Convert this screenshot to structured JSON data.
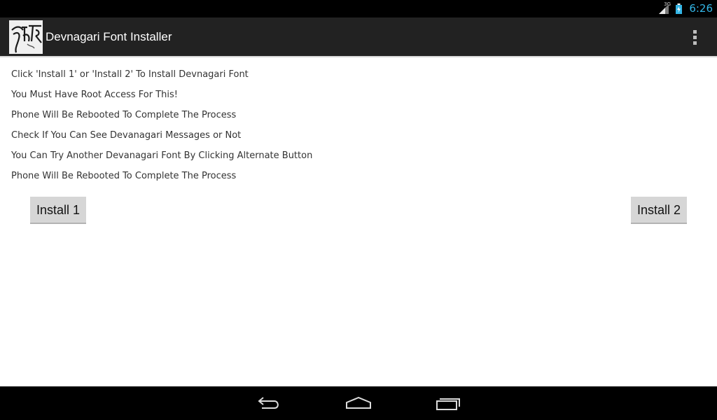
{
  "status_bar": {
    "network_type": "3G",
    "time": "6:26",
    "icons": [
      "signal-icon",
      "battery-charging-icon"
    ]
  },
  "action_bar": {
    "title": "Devnagari Font Installer",
    "logo_icon": "app-logo-icon",
    "menu_icon": "overflow-menu-icon"
  },
  "content": {
    "lines": [
      "Click 'Install 1' or 'Install 2' To Install Devnagari Font",
      "You Must Have Root Access For This!",
      "Phone Will Be Rebooted To Complete The Process",
      "Check If You Can See Devanagari Messages or Not",
      "You Can Try Another Devanagari Font By Clicking Alternate Button",
      "Phone Will Be Rebooted To Complete The Process"
    ]
  },
  "buttons": {
    "install1": "Install 1",
    "install2": "Install 2"
  },
  "nav_bar": {
    "icons": [
      "back-icon",
      "home-icon",
      "recents-icon"
    ]
  },
  "colors": {
    "accent": "#33b5e5",
    "action_bar": "#222222",
    "status_bar": "#000000",
    "button": "#d6d6d6"
  }
}
